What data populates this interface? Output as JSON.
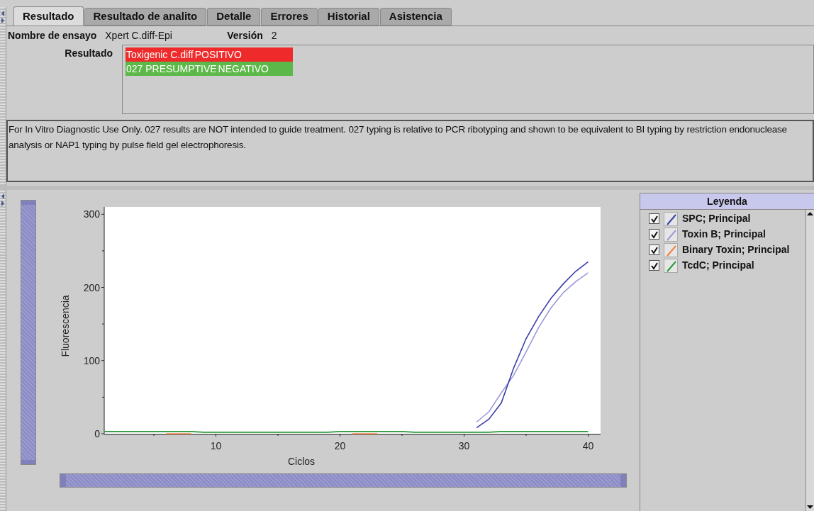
{
  "tabs": [
    {
      "label": "Resultado",
      "selected": true
    },
    {
      "label": "Resultado de analito",
      "selected": false
    },
    {
      "label": "Detalle",
      "selected": false
    },
    {
      "label": "Errores",
      "selected": false
    },
    {
      "label": "Historial",
      "selected": false
    },
    {
      "label": "Asistencia",
      "selected": false
    }
  ],
  "assay": {
    "name_label": "Nombre de ensayo",
    "name": "Xpert C.diff-Epi",
    "version_label": "Versión",
    "version": "2"
  },
  "result": {
    "label": "Resultado",
    "lines": [
      {
        "name": "Toxigenic C.diff",
        "value": "POSITIVO",
        "color": "#ee2a2a"
      },
      {
        "name": "027 PRESUMPTIVE",
        "value": "NEGATIVO",
        "color": "#5cb848"
      }
    ]
  },
  "notice": "For In Vitro Diagnostic Use Only. 027 results are NOT intended to guide treatment. 027 typing is relative to PCR ribotyping and shown to be equivalent to BI typing by restriction endonuclease analysis or NAP1 typing by pulse field gel electrophoresis.",
  "chart": {
    "y_range_slider": {
      "level": 1
    },
    "x_range_slider": {
      "level": 1
    },
    "chart_data": {
      "type": "line",
      "xlabel": "Ciclos",
      "ylabel": "Fluorescencia",
      "x": [
        1,
        2,
        3,
        4,
        5,
        6,
        7,
        8,
        9,
        10,
        11,
        12,
        13,
        14,
        15,
        16,
        17,
        18,
        19,
        20,
        21,
        22,
        23,
        24,
        25,
        26,
        27,
        28,
        29,
        30,
        31,
        32,
        33,
        34,
        35,
        36,
        37,
        38,
        39,
        40
      ],
      "xlim": [
        1,
        41
      ],
      "ylim": [
        0,
        310
      ],
      "xticks": [
        10,
        20,
        30,
        40
      ],
      "yticks": [
        0,
        100,
        200,
        300
      ],
      "series": [
        {
          "name": "SPC; Principal",
          "color": "#3a3fa8",
          "values": [
            null,
            null,
            null,
            null,
            null,
            null,
            null,
            null,
            null,
            null,
            null,
            null,
            null,
            null,
            null,
            null,
            null,
            null,
            null,
            null,
            null,
            null,
            null,
            null,
            null,
            null,
            null,
            null,
            null,
            null,
            8,
            20,
            42,
            90,
            130,
            160,
            185,
            205,
            222,
            235
          ]
        },
        {
          "name": "Toxin B; Principal",
          "color": "#9a9ad8",
          "values": [
            null,
            null,
            null,
            null,
            null,
            null,
            null,
            null,
            null,
            null,
            null,
            null,
            null,
            null,
            null,
            null,
            null,
            null,
            null,
            null,
            null,
            null,
            null,
            null,
            null,
            null,
            null,
            null,
            null,
            null,
            16,
            30,
            56,
            80,
            112,
            145,
            172,
            193,
            208,
            220
          ]
        },
        {
          "name": "Binary Toxin; Principal",
          "color": "#f08040",
          "values": [
            null,
            null,
            null,
            null,
            null,
            0,
            0,
            0,
            null,
            null,
            null,
            null,
            null,
            null,
            null,
            null,
            null,
            null,
            null,
            null,
            0,
            0,
            0,
            null,
            null,
            null,
            null,
            null,
            null,
            null,
            null,
            null,
            null,
            null,
            null,
            null,
            null,
            null,
            null,
            null
          ]
        },
        {
          "name": "TcdC; Principal",
          "color": "#2a9a3a",
          "values": [
            3,
            3,
            3,
            3,
            3,
            3,
            3,
            3,
            2,
            2,
            2,
            2,
            2,
            2,
            2,
            2,
            2,
            2,
            2,
            3,
            3,
            3,
            3,
            3,
            3,
            2,
            2,
            2,
            2,
            2,
            2,
            2,
            3,
            3,
            3,
            3,
            3,
            3,
            3,
            3
          ]
        }
      ]
    }
  },
  "legend": {
    "title": "Leyenda",
    "items": [
      {
        "checked": true
      },
      {
        "checked": true
      },
      {
        "checked": true
      },
      {
        "checked": true
      }
    ]
  }
}
